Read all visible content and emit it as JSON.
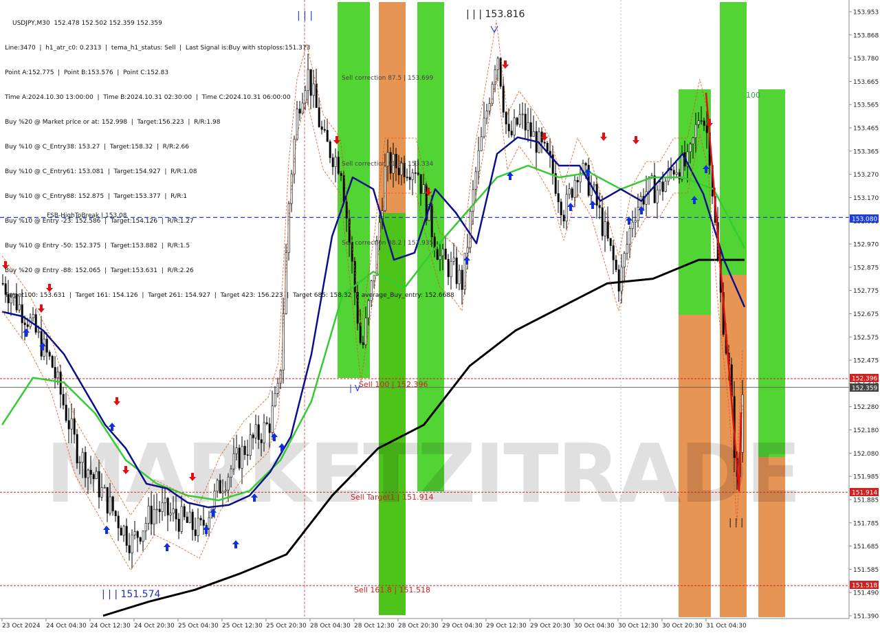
{
  "chart_data": {
    "type": "candlestick",
    "symbol": "USDJPY",
    "timeframe": "M30",
    "ohlc_header": "USDJPY,M30  152.478 152.502 152.359 152.359",
    "info_lines": [
      "Line:3470  |  h1_atr_c0: 0.2313  |  tema_h1_status: Sell  |  Last Signal is:Buy with stoploss:151.373",
      "Point A:152.775  |  Point B:153.576  |  Point C:152.83",
      "Time A:2024.10.30 13:00:00  |  Time B:2024.10.31 02:30:00  |  Time C:2024.10.31 06:00:00",
      "Buy %20 @ Market price or at: 152.998  |  Target:156.223  |  R/R:1.98",
      "Buy %10 @ C_Entry38: 153.27  |  Target:158.32  |  R/R:2.66",
      "Buy %10 @ C_Entry61: 153.081  |  Target:154.927  |  R/R:1.08",
      "Buy %10 @ C_Entry88: 152.875  |  Target:153.377  |  R/R:1",
      "Buy %10 @ Entry -23: 152.586  |  Target:154.126  |  R/R:1.27",
      "Buy %10 @ Entry -50: 152.375  |  Target:153.882  |  R/R:1.5",
      "Buy %20 @ Entry -88: 152.065  |  Target:153.631  |  R/R:2.26",
      "Target100: 153.631  |  Target 161: 154.126  |  Target 261: 154.927  |  Target 423: 156.223  |  Target 685: 158.32  |  average_Buy_entry: 152.6688"
    ],
    "y_range": [
      151.39,
      153.98
    ],
    "y_ticks": [
      "153.953",
      "153.868",
      "153.780",
      "153.665",
      "153.565",
      "153.465",
      "153.365",
      "153.270",
      "153.170",
      "153.080",
      "152.970",
      "152.875",
      "152.775",
      "152.675",
      "152.575",
      "152.475",
      "152.375",
      "152.280",
      "152.180",
      "152.080",
      "151.985",
      "151.885",
      "151.785",
      "151.685",
      "151.585",
      "151.490",
      "151.390"
    ],
    "x_labels": [
      "23 Oct 2024",
      "24 Oct 04:30",
      "24 Oct 12:30",
      "24 Oct 20:30",
      "25 Oct 04:30",
      "25 Oct 12:30",
      "25 Oct 20:30",
      "28 Oct 04:30",
      "28 Oct 12:30",
      "28 Oct 20:30",
      "29 Oct 04:30",
      "29 Oct 12:30",
      "29 Oct 20:30",
      "30 Oct 04:30",
      "30 Oct 12:30",
      "30 Oct 20:30",
      "31 Oct 04:30"
    ],
    "price_badges": [
      {
        "label": "153.080",
        "color": "#1f3fd6"
      },
      {
        "label": "152.396",
        "color": "#cc2222"
      },
      {
        "label": "152.359",
        "color": "#444444"
      },
      {
        "label": "151.914",
        "color": "#cc2222"
      },
      {
        "label": "151.518",
        "color": "#cc2222"
      }
    ],
    "annotations": [
      "FSB-HighToBreak | 153.08",
      "Sell correction 87.5 | 153.699",
      "Sell correction 61.8 | 153.334",
      "Sell correction 38.2 | 152.935",
      "Sell 100 | 152.396",
      "Sell Target1 | 151.914",
      "Sell 161.8 | 151.518",
      "| | | 153.816",
      "| | | 151.574",
      "100",
      "| | |",
      "| | |",
      "| V"
    ],
    "watermark": "MARKETZITRADE",
    "colors": {
      "ma_blue": "#0a0f8a",
      "ma_green": "#33cc33",
      "ma_black": "#000000",
      "zone_green": "#33cc11",
      "zone_orange": "#e07a2a",
      "dash_red": "#cc2222",
      "dash_blue": "#1f3fd6",
      "candle": "#000000"
    },
    "ma_blue": [
      152.68,
      152.66,
      152.6,
      152.5,
      152.35,
      152.2,
      152.1,
      151.95,
      151.93,
      151.87,
      151.85,
      151.86,
      151.9,
      152.0,
      152.15,
      152.5,
      153.0,
      153.25,
      153.2,
      152.9,
      152.93,
      153.2,
      153.1,
      152.97,
      153.35,
      153.42,
      153.4,
      153.3,
      153.3,
      153.15,
      153.2,
      153.15,
      153.25,
      153.35,
      153.18,
      152.9,
      152.7
    ],
    "ma_green": [
      152.2,
      152.4,
      152.38,
      152.25,
      152.05,
      151.95,
      151.9,
      151.88,
      151.92,
      152.05,
      152.3,
      152.75,
      152.85,
      152.78,
      152.95,
      153.1,
      153.25,
      153.3,
      153.25,
      153.27,
      153.2,
      153.25,
      153.25,
      153.2,
      152.95
    ],
    "ma_black": [
      151.39,
      151.45,
      151.5,
      151.57,
      151.65,
      151.9,
      152.1,
      152.2,
      152.45,
      152.6,
      152.7,
      152.8,
      152.82,
      152.9,
      152.9
    ]
  }
}
